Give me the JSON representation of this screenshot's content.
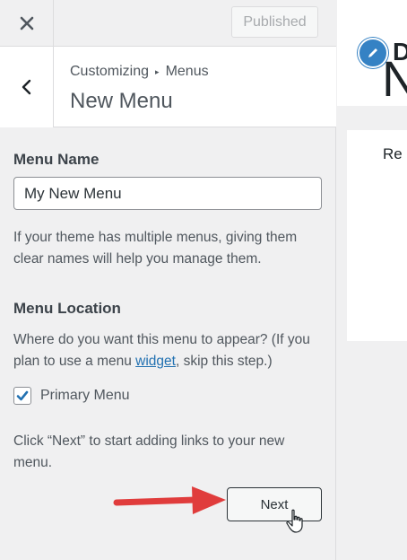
{
  "topbar": {
    "published_label": "Published"
  },
  "header": {
    "breadcrumb_root": "Customizing",
    "breadcrumb_separator": "▸",
    "breadcrumb_current": "Menus",
    "title": "New Menu"
  },
  "form": {
    "name_label": "Menu Name",
    "name_value": "My New Menu",
    "name_help": "If your theme has multiple menus, giving them clear names will help you manage them.",
    "location_label": "Menu Location",
    "location_help_before": "Where do you want this menu to appear? (If you plan to use a menu ",
    "location_help_link": "widget",
    "location_help_after": ", skip this step.)",
    "primary_menu_label": "Primary Menu",
    "primary_menu_checked": true,
    "next_help": "Click “Next” to start adding links to your new menu.",
    "next_label": "Next"
  },
  "preview": {
    "site_title_visible": "D",
    "heading_visible": "N",
    "text_visible": "Re"
  },
  "colors": {
    "accent": "#2271b1",
    "arrow": "#e03c3c",
    "edit_icon_bg": "#3582c4"
  },
  "icons": {
    "close": "close-icon",
    "back": "chevron-left-icon",
    "check": "checkmark-icon",
    "edit": "pencil-icon",
    "cursor": "hand-pointer-icon",
    "arrow": "red-arrow-annotation"
  }
}
